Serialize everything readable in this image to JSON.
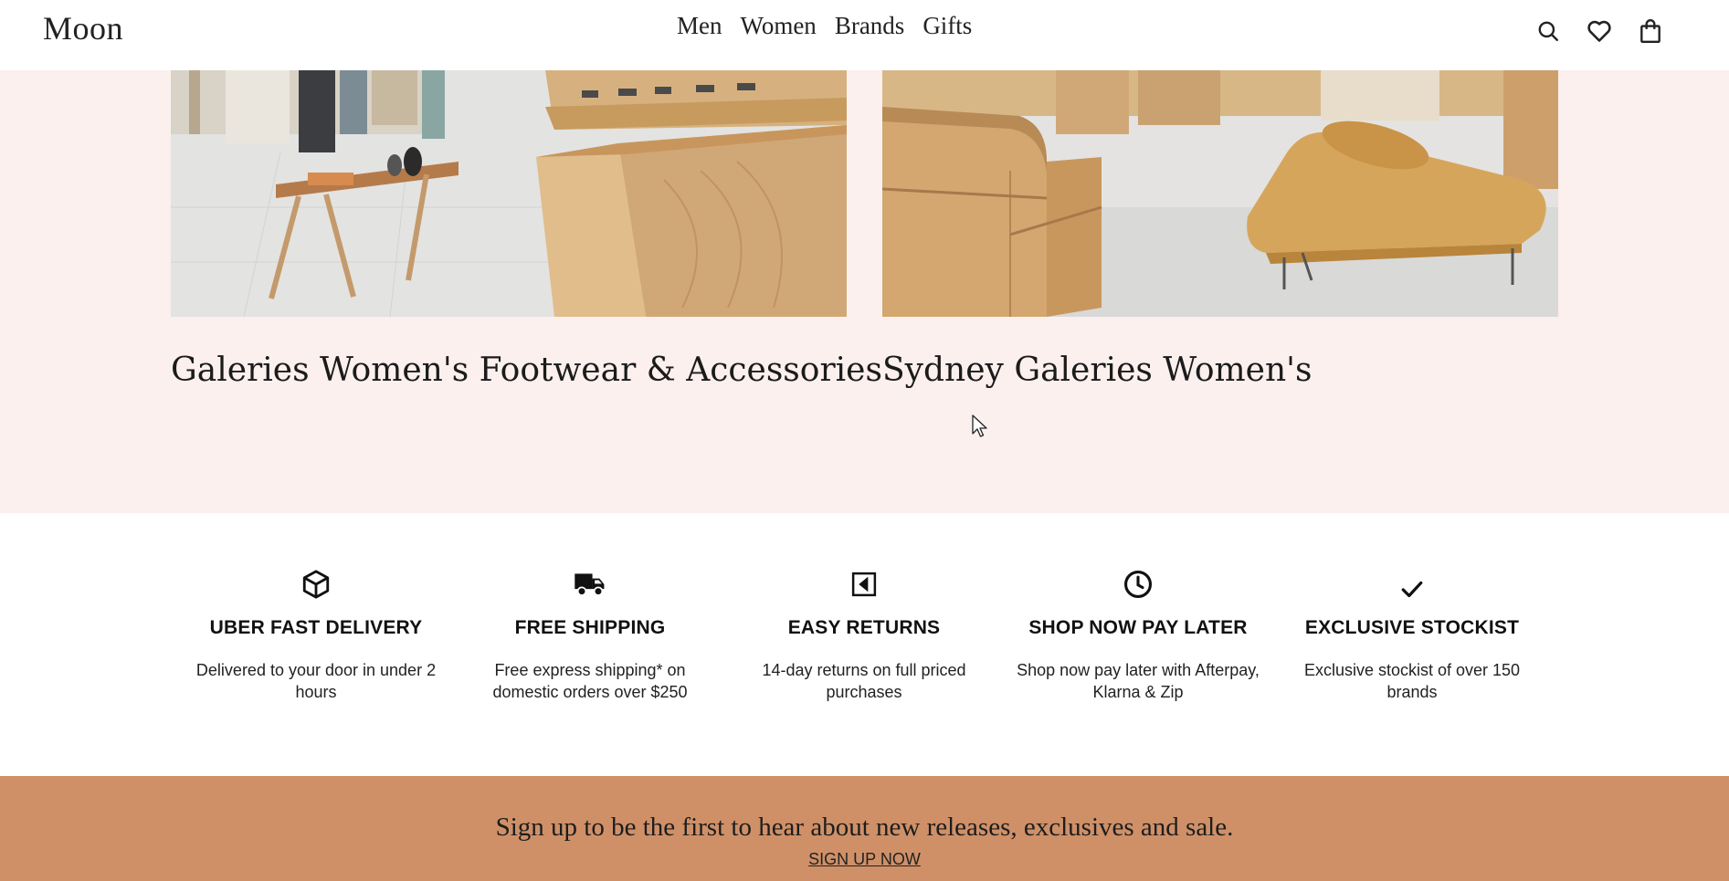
{
  "header": {
    "logo": "Moon",
    "nav": [
      "Men",
      "Women",
      "Brands",
      "Gifts"
    ],
    "icons": [
      "search-icon",
      "heart-icon",
      "bag-icon"
    ]
  },
  "stores": [
    {
      "title": "Galeries Women's Footwear & Accessories"
    },
    {
      "title": "Sydney Galeries Women's"
    }
  ],
  "features": [
    {
      "icon": "box-icon",
      "title": "UBER FAST DELIVERY",
      "desc": "Delivered to your door in under 2 hours"
    },
    {
      "icon": "truck-icon",
      "title": "FREE SHIPPING",
      "desc": "Free express shipping* on domestic orders over $250"
    },
    {
      "icon": "return-icon",
      "title": "EASY RETURNS",
      "desc": "14-day returns on full priced purchases"
    },
    {
      "icon": "clock-icon",
      "title": "SHOP NOW PAY LATER",
      "desc": "Shop now pay later with Afterpay, Klarna & Zip"
    },
    {
      "icon": "check-icon",
      "title": "EXCLUSIVE STOCKIST",
      "desc": "Exclusive stockist of over 150 brands"
    }
  ],
  "signup": {
    "text": "Sign up to be the first to hear about new releases, exclusives and sale.",
    "link": "SIGN UP NOW"
  },
  "colors": {
    "stores_bg": "#fbf0ee",
    "signup_bg": "#cf9068",
    "text": "#111111"
  }
}
